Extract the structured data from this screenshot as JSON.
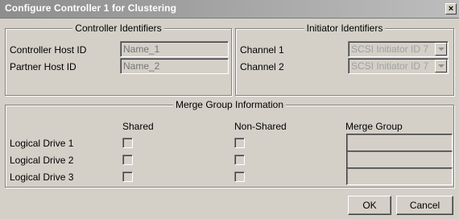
{
  "window": {
    "title": "Configure Controller 1 for Clustering",
    "close_glyph": "×"
  },
  "controller_identifiers": {
    "title": "Controller Identifiers",
    "controller_host_id": {
      "label": "Controller Host ID",
      "placeholder": "Name_1"
    },
    "partner_host_id": {
      "label": "Partner Host ID",
      "placeholder": "Name_2"
    }
  },
  "initiator_identifiers": {
    "title": "Initiator Identifiers",
    "channels": [
      {
        "label": "Channel 1",
        "value": "SCSI Initiator ID 7"
      },
      {
        "label": "Channel 2",
        "value": "SCSI Initiator ID 7"
      }
    ]
  },
  "merge_group": {
    "title": "Merge Group Information",
    "headers": {
      "shared": "Shared",
      "non_shared": "Non-Shared",
      "merge_group": "Merge Group"
    },
    "drives": [
      {
        "label": "Logical Drive 1",
        "shared": false,
        "non_shared": false,
        "merge_group": ""
      },
      {
        "label": "Logical Drive 2",
        "shared": false,
        "non_shared": false,
        "merge_group": ""
      },
      {
        "label": "Logical Drive 3",
        "shared": false,
        "non_shared": false,
        "merge_group": ""
      }
    ]
  },
  "buttons": {
    "ok": "OK",
    "cancel": "Cancel"
  }
}
